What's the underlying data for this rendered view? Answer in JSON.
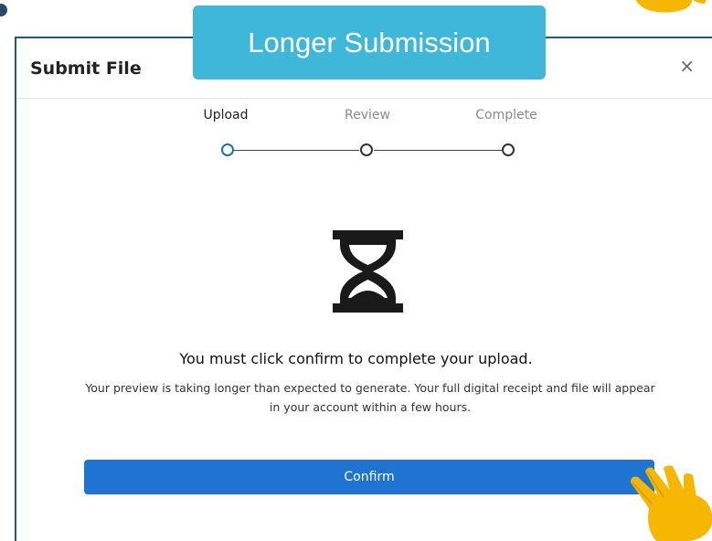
{
  "banner": {
    "text": "Longer Submission",
    "color": "#3fb7d8"
  },
  "modal": {
    "title": "Submit File",
    "close_glyph": "×"
  },
  "steps": [
    {
      "label": "Upload",
      "state": "active"
    },
    {
      "label": "Review",
      "state": "inactive"
    },
    {
      "label": "Complete",
      "state": "inactive"
    }
  ],
  "status_icon": "hourglass-icon",
  "message": {
    "title": "You must click confirm to complete your upload.",
    "body": "Your preview is taking longer than expected to generate. Your full digital receipt and file will appear in your account within a few hours."
  },
  "confirm_button": {
    "label": "Confirm",
    "color": "#1e74d0"
  },
  "accent_color": "#1e6fb5"
}
